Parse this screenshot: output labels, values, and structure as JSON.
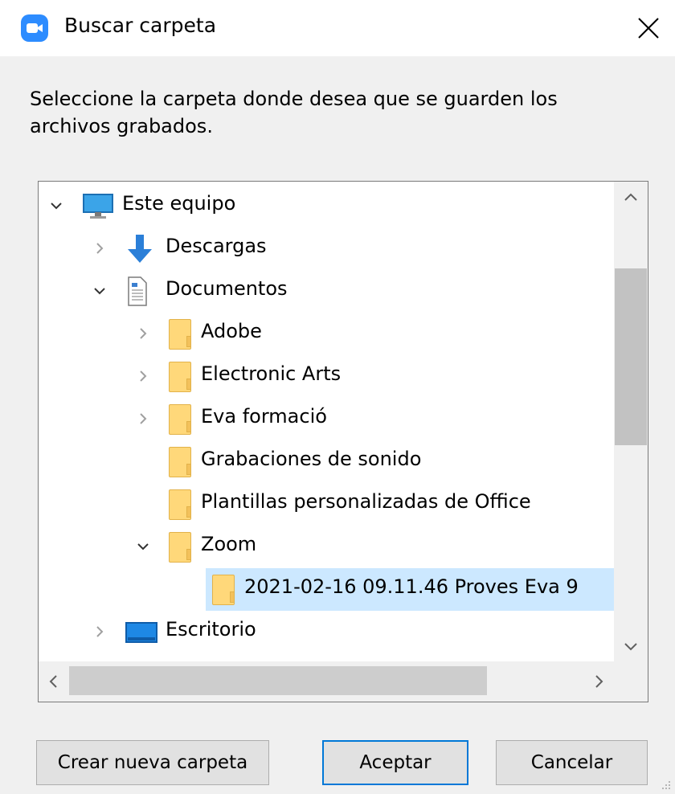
{
  "window": {
    "title": "Buscar carpeta",
    "app_icon": "zoom-icon",
    "close_icon": "close-icon"
  },
  "instructions": "Seleccione la carpeta donde desea que se guarden los archivos grabados.",
  "tree": {
    "items": [
      {
        "label": "Este equipo",
        "icon": "computer-icon",
        "expander": "expanded",
        "level": 0,
        "selected": false
      },
      {
        "label": "Descargas",
        "icon": "download-icon",
        "expander": "collapsed",
        "level": 1,
        "selected": false
      },
      {
        "label": "Documentos",
        "icon": "document-icon",
        "expander": "expanded",
        "level": 1,
        "selected": false
      },
      {
        "label": "Adobe",
        "icon": "folder-icon",
        "expander": "collapsed",
        "level": 2,
        "selected": false
      },
      {
        "label": "Electronic Arts",
        "icon": "folder-icon",
        "expander": "collapsed",
        "level": 2,
        "selected": false
      },
      {
        "label": "Eva formació",
        "icon": "folder-icon",
        "expander": "collapsed",
        "level": 2,
        "selected": false
      },
      {
        "label": "Grabaciones de sonido",
        "icon": "folder-icon",
        "expander": "none",
        "level": 2,
        "selected": false
      },
      {
        "label": "Plantillas personalizadas de Office",
        "icon": "folder-icon",
        "expander": "none",
        "level": 2,
        "selected": false
      },
      {
        "label": "Zoom",
        "icon": "folder-icon",
        "expander": "expanded",
        "level": 2,
        "selected": false
      },
      {
        "label": "2021-02-16 09.11.46 Proves Eva 9",
        "icon": "folder-icon",
        "expander": "none",
        "level": 3,
        "selected": true
      },
      {
        "label": "Escritorio",
        "icon": "desktop-icon",
        "expander": "collapsed",
        "level": 1,
        "selected": false
      }
    ]
  },
  "buttons": {
    "new_folder": "Crear nueva carpeta",
    "accept": "Aceptar",
    "cancel": "Cancelar"
  },
  "colors": {
    "selection": "#cce8ff",
    "accent": "#0078d7",
    "zoom_blue": "#2d8cff",
    "folder": "#ffd87a"
  }
}
